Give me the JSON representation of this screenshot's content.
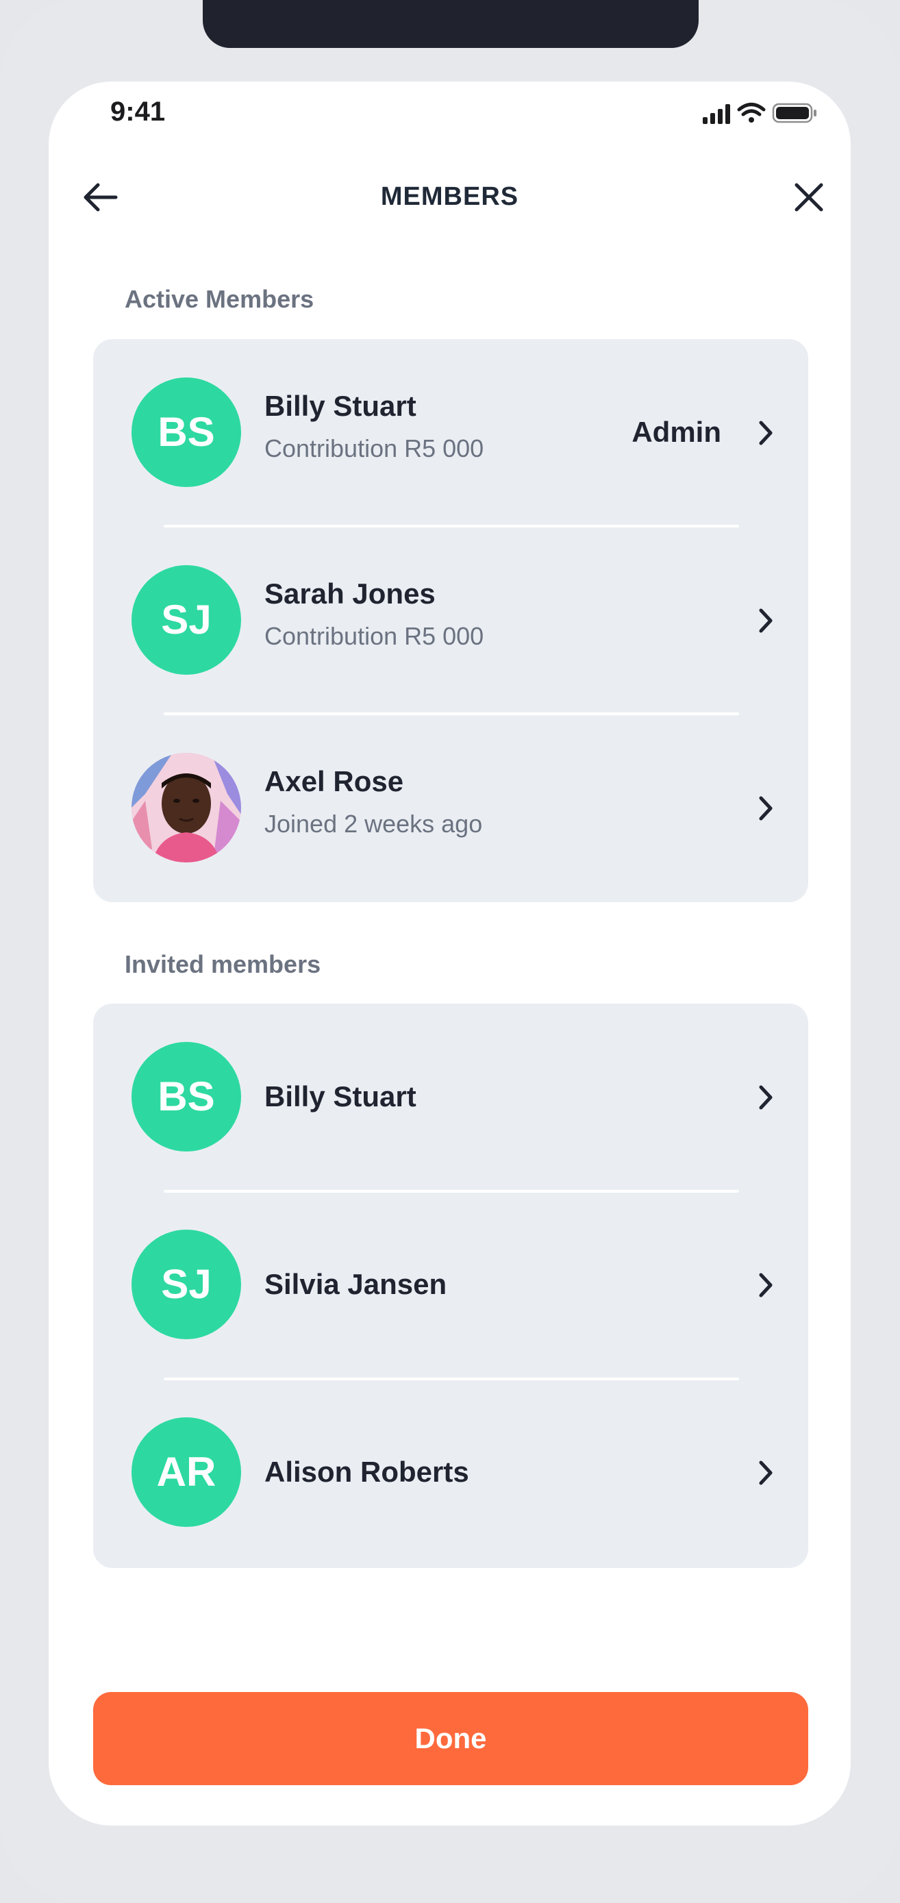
{
  "status_bar": {
    "time": "9:41"
  },
  "header": {
    "title": "MEMBERS"
  },
  "active_section": {
    "label": "Active Members",
    "members": [
      {
        "initials": "BS",
        "name": "Billy Stuart",
        "detail": "Contribution R5 000",
        "role": "Admin"
      },
      {
        "initials": "SJ",
        "name": "Sarah Jones",
        "detail": "Contribution R5 000",
        "role": ""
      },
      {
        "initials": "",
        "name": "Axel Rose",
        "detail": "Joined 2 weeks ago",
        "role": ""
      }
    ]
  },
  "invited_section": {
    "label": "Invited members",
    "members": [
      {
        "initials": "BS",
        "name": "Billy Stuart"
      },
      {
        "initials": "SJ",
        "name": "Silvia Jansen"
      },
      {
        "initials": "AR",
        "name": "Alison Roberts"
      }
    ]
  },
  "done_button": {
    "label": "Done"
  },
  "colors": {
    "accent": "#fe6a3c",
    "avatar": "#2dd9a0",
    "card": "#eaeef3"
  }
}
